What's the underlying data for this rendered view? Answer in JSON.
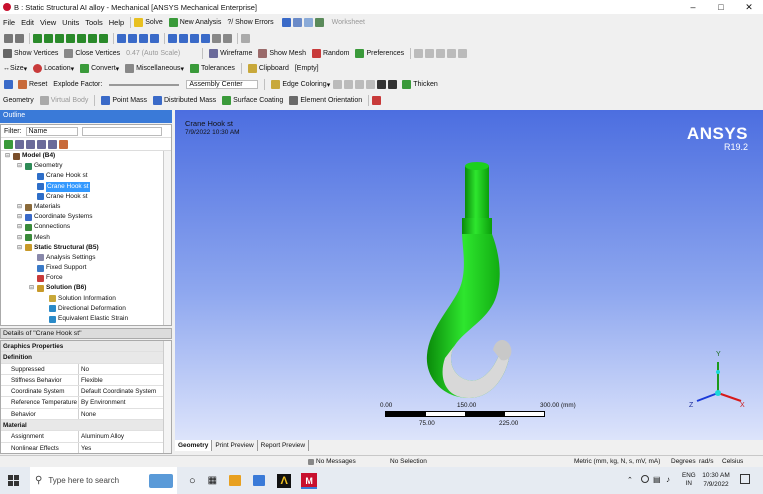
{
  "window": {
    "title": "B : Static Structural AI alloy - Mechanical [ANSYS Mechanical Enterprise]"
  },
  "menu": [
    "File",
    "Edit",
    "View",
    "Units",
    "Tools",
    "Help"
  ],
  "toolbar1": {
    "solve": "Solve",
    "new_analysis": "New Analysis",
    "show_errors": "?/ Show Errors",
    "worksheet": "Worksheet"
  },
  "toolbar3": {
    "show_vertices": "Show Vertices",
    "close_vertices": "Close Vertices",
    "auto_scale": "0.47 (Auto Scale)",
    "wireframe": "Wireframe",
    "show_mesh": "Show Mesh",
    "random": "Random",
    "preferences": "Preferences"
  },
  "toolbar4": {
    "size": "Size",
    "location": "Location",
    "convert": "Convert",
    "miscellaneous": "Miscellaneous",
    "tolerances": "Tolerances",
    "clipboard": "Clipboard",
    "clipboard_state": "[Empty]"
  },
  "toolbar5": {
    "reset": "Reset",
    "explode_factor": "Explode Factor:",
    "assembly_center": "Assembly Center",
    "edge_coloring": "Edge Coloring",
    "thicken": "Thicken"
  },
  "toolbar6": {
    "geometry": "Geometry",
    "virtual_body": "Virtual Body",
    "point_mass": "Point Mass",
    "distributed_mass": "Distributed Mass",
    "surface_coating": "Surface Coating",
    "element_orientation": "Element Orientation"
  },
  "outline": {
    "header": "Outline",
    "filter_label": "Filter:",
    "filter_value": "Name",
    "nodes": [
      {
        "label": "Model (B4)",
        "bold": true,
        "depth": 0,
        "color": "#7a4e2a"
      },
      {
        "label": "Geometry",
        "depth": 1,
        "color": "#2e8b57"
      },
      {
        "label": "Crane Hook st",
        "depth": 2,
        "color": "#2e6ec8"
      },
      {
        "label": "Crane Hook st",
        "depth": 2,
        "color": "#2e6ec8",
        "selected": true
      },
      {
        "label": "Crane Hook st",
        "depth": 2,
        "color": "#2e6ec8"
      },
      {
        "label": "Materials",
        "depth": 1,
        "color": "#8a6a3a"
      },
      {
        "label": "Coordinate Systems",
        "depth": 1,
        "color": "#3a6ac8"
      },
      {
        "label": "Connections",
        "depth": 1,
        "color": "#3a8a3a"
      },
      {
        "label": "Mesh",
        "depth": 1,
        "color": "#3a8a3a"
      },
      {
        "label": "Static Structural (B5)",
        "bold": true,
        "depth": 1,
        "color": "#c89a2a"
      },
      {
        "label": "Analysis Settings",
        "depth": 2,
        "color": "#8888aa"
      },
      {
        "label": "Fixed Support",
        "depth": 2,
        "color": "#3a7ac8"
      },
      {
        "label": "Force",
        "depth": 2,
        "color": "#c83a3a"
      },
      {
        "label": "Solution (B6)",
        "bold": true,
        "depth": 2,
        "color": "#c89a2a"
      },
      {
        "label": "Solution Information",
        "depth": 3,
        "color": "#c8a83a"
      },
      {
        "label": "Directional Deformation",
        "depth": 3,
        "color": "#2a8ac8"
      },
      {
        "label": "Equivalent Elastic Strain",
        "depth": 3,
        "color": "#2a8ac8"
      }
    ]
  },
  "details": {
    "header": "Details of \"Crane Hook st\"",
    "rows": [
      {
        "group": "Graphics Properties"
      },
      {
        "group": "Definition"
      },
      {
        "k": "Suppressed",
        "v": "No"
      },
      {
        "k": "Stiffness Behavior",
        "v": "Flexible"
      },
      {
        "k": "Coordinate System",
        "v": "Default Coordinate System"
      },
      {
        "k": "Reference Temperature",
        "v": "By Environment"
      },
      {
        "k": "Behavior",
        "v": "None"
      },
      {
        "group": "Material"
      },
      {
        "k": "Assignment",
        "v": "Aluminum Alloy"
      },
      {
        "k": "Nonlinear Effects",
        "v": "Yes"
      }
    ]
  },
  "viewport": {
    "model_title": "Crane Hook st",
    "timestamp": "7/9/2022 10:30 AM",
    "brand": "ANSYS",
    "version": "R19.2",
    "scale_labels_top": [
      "0.00",
      "150.00",
      "300.00 (mm)"
    ],
    "scale_labels_bottom": [
      "75.00",
      "225.00"
    ],
    "axis_y": "Y",
    "axis_z": "Z",
    "axis_x": "X"
  },
  "tabs": [
    "Geometry",
    "Print Preview",
    "Report Preview"
  ],
  "status": {
    "messages": "No Messages",
    "selection": "No Selection",
    "units": "Metric (mm, kg, N, s, mV, mA)",
    "angle": "Degrees",
    "ang_vel": "rad/s",
    "temp": "Celsius"
  },
  "taskbar": {
    "search_placeholder": "Type here to search",
    "lang1": "ENG",
    "lang2": "IN",
    "time": "10:30 AM",
    "date": "7/9/2022"
  },
  "colors": {
    "hook_green": "#16c116",
    "viewport_top": "#4c6ee0",
    "selection": "#3399ff"
  }
}
